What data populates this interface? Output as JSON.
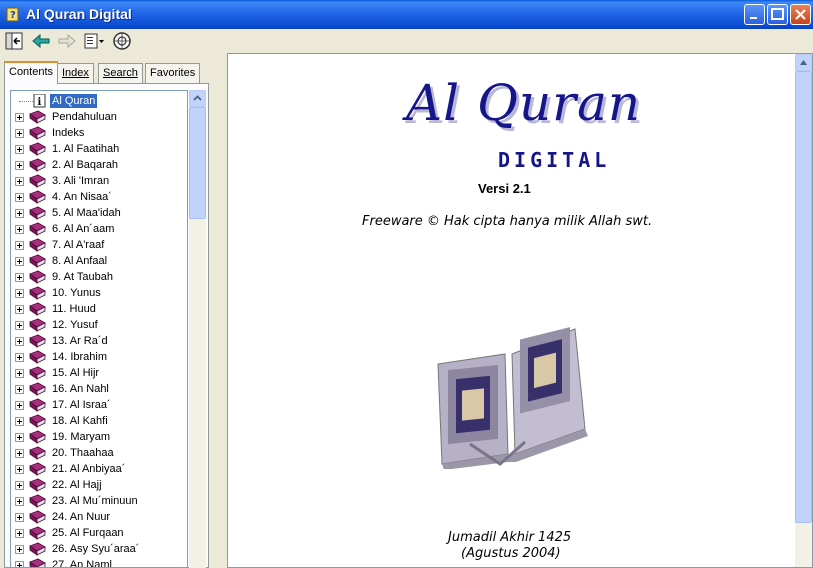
{
  "window": {
    "title": "Al Quran Digital"
  },
  "toolbar": {
    "buttons": [
      "hide-icon",
      "back-arrow-icon",
      "forward-arrow-icon",
      "options-icon",
      "web-help-icon"
    ]
  },
  "tabs": [
    {
      "label": "Contents",
      "active": true
    },
    {
      "label": "Index",
      "active": false
    },
    {
      "label": "Search",
      "active": false
    },
    {
      "label": "Favorites",
      "active": false
    }
  ],
  "tree": {
    "items": [
      {
        "label": "Al Quran",
        "icon": "info-page-icon",
        "selected": true
      },
      {
        "label": "Pendahuluan",
        "icon": "book-icon"
      },
      {
        "label": "Indeks",
        "icon": "book-icon"
      },
      {
        "label": "1. Al Faatihah",
        "icon": "book-icon"
      },
      {
        "label": "2. Al Baqarah",
        "icon": "book-icon"
      },
      {
        "label": "3. Ali 'Imran",
        "icon": "book-icon"
      },
      {
        "label": "4. An Nisaa´",
        "icon": "book-icon"
      },
      {
        "label": "5. Al Maa'idah",
        "icon": "book-icon"
      },
      {
        "label": "6. Al An´aam",
        "icon": "book-icon"
      },
      {
        "label": "7. Al A'raaf",
        "icon": "book-icon"
      },
      {
        "label": "8. Al Anfaal",
        "icon": "book-icon"
      },
      {
        "label": "9. At Taubah",
        "icon": "book-icon"
      },
      {
        "label": "10. Yunus",
        "icon": "book-icon"
      },
      {
        "label": "11. Huud",
        "icon": "book-icon"
      },
      {
        "label": "12. Yusuf",
        "icon": "book-icon"
      },
      {
        "label": "13. Ar Ra´d",
        "icon": "book-icon"
      },
      {
        "label": "14. Ibrahim",
        "icon": "book-icon"
      },
      {
        "label": "15. Al Hijr",
        "icon": "book-icon"
      },
      {
        "label": "16. An Nahl",
        "icon": "book-icon"
      },
      {
        "label": "17. Al Israa´",
        "icon": "book-icon"
      },
      {
        "label": "18. Al Kahfi",
        "icon": "book-icon"
      },
      {
        "label": "19. Maryam",
        "icon": "book-icon"
      },
      {
        "label": "20. Thaahaa",
        "icon": "book-icon"
      },
      {
        "label": "21. Al Anbiyaa´",
        "icon": "book-icon"
      },
      {
        "label": "22. Al Hajj",
        "icon": "book-icon"
      },
      {
        "label": "23. Al Mu´minuun",
        "icon": "book-icon"
      },
      {
        "label": "24. An Nuur",
        "icon": "book-icon"
      },
      {
        "label": "25. Al Furqaan",
        "icon": "book-icon"
      },
      {
        "label": "26. Asy Syu´araa´",
        "icon": "book-icon"
      },
      {
        "label": "27. An Naml",
        "icon": "book-icon"
      }
    ]
  },
  "content": {
    "title": "Al Quran",
    "subtitle": "DIGITAL",
    "version": "Versi 2.1",
    "copyright": "Freeware © Hak cipta hanya milik Allah swt.",
    "image": "open-quran-book-icon",
    "date_hijri": "Jumadil Akhir 1425",
    "date_gregorian": "(Agustus 2004)"
  },
  "colors": {
    "title_blue": "#16168a",
    "selection": "#316ac5",
    "titlebar": "#0b4fd6"
  }
}
